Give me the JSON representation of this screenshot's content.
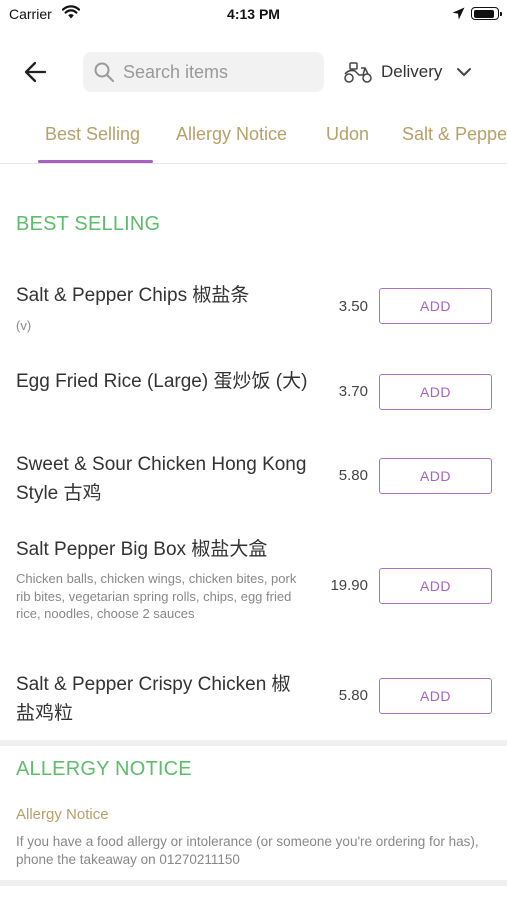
{
  "status_bar": {
    "carrier": "Carrier",
    "time": "4:13 PM"
  },
  "header": {
    "search_placeholder": "Search items",
    "delivery_label": "Delivery"
  },
  "tabs": [
    {
      "label": "Best Selling",
      "active": true
    },
    {
      "label": "Allergy Notice",
      "active": false
    },
    {
      "label": "Udon",
      "active": false
    },
    {
      "label": "Salt & Pepper",
      "active": false
    }
  ],
  "sections": {
    "best_selling": {
      "title": "BEST SELLING",
      "items": [
        {
          "name": "Salt & Pepper Chips 椒盐条",
          "description": "(v)",
          "price": "3.50",
          "button": "ADD"
        },
        {
          "name": "Egg Fried Rice (Large) 蛋炒饭 (大)",
          "description": "",
          "price": "3.70",
          "button": "ADD"
        },
        {
          "name": "Sweet & Sour Chicken Hong Kong Style 古鸡",
          "description": "",
          "price": "5.80",
          "button": "ADD"
        },
        {
          "name": "Salt Pepper Big Box 椒盐大盒",
          "description": "Chicken balls, chicken wings, chicken bites, pork rib bites,  vegetarian spring rolls, chips, egg fried rice, noodles, choose 2 sauces",
          "price": "19.90",
          "button": "ADD"
        },
        {
          "name": "Salt & Pepper Crispy Chicken 椒盐鸡粒",
          "description": "",
          "price": "5.80",
          "button": "ADD"
        }
      ]
    },
    "allergy_notice": {
      "title": "ALLERGY NOTICE",
      "subtitle": "Allergy Notice",
      "text": "If you have a food allergy or intolerance (or someone you're ordering for has), phone the takeaway on 01270211150"
    }
  },
  "colors": {
    "accent_purple": "#a864c0",
    "section_green": "#5dbd6a",
    "tab_gold": "#b7a06a"
  }
}
